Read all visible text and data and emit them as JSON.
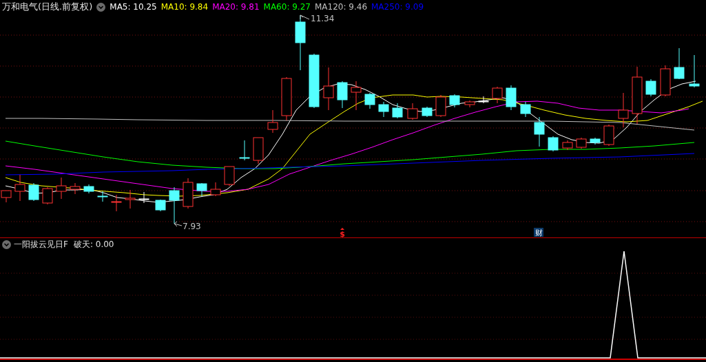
{
  "main_pane": {
    "title": "万和电气(日线.前复权)",
    "legend": [
      {
        "label": "MA5: 10.25",
        "color": "#ffffff"
      },
      {
        "label": "MA10: 9.84",
        "color": "#ffff00"
      },
      {
        "label": "MA20: 9.81",
        "color": "#ff00ff"
      },
      {
        "label": "MA60: 9.27",
        "color": "#00ff00"
      },
      {
        "label": "MA120: 9.46",
        "color": "#c0c0c0"
      },
      {
        "label": "MA250: 9.09",
        "color": "#0000ff"
      }
    ],
    "high_label": "11.34",
    "low_label": "7.93",
    "markers": [
      {
        "kind": "dividend",
        "text": "$"
      },
      {
        "kind": "finance",
        "text": "财"
      }
    ]
  },
  "indicator_pane": {
    "name": "一阳拔云见日F",
    "value": "破天: 0.00"
  }
}
